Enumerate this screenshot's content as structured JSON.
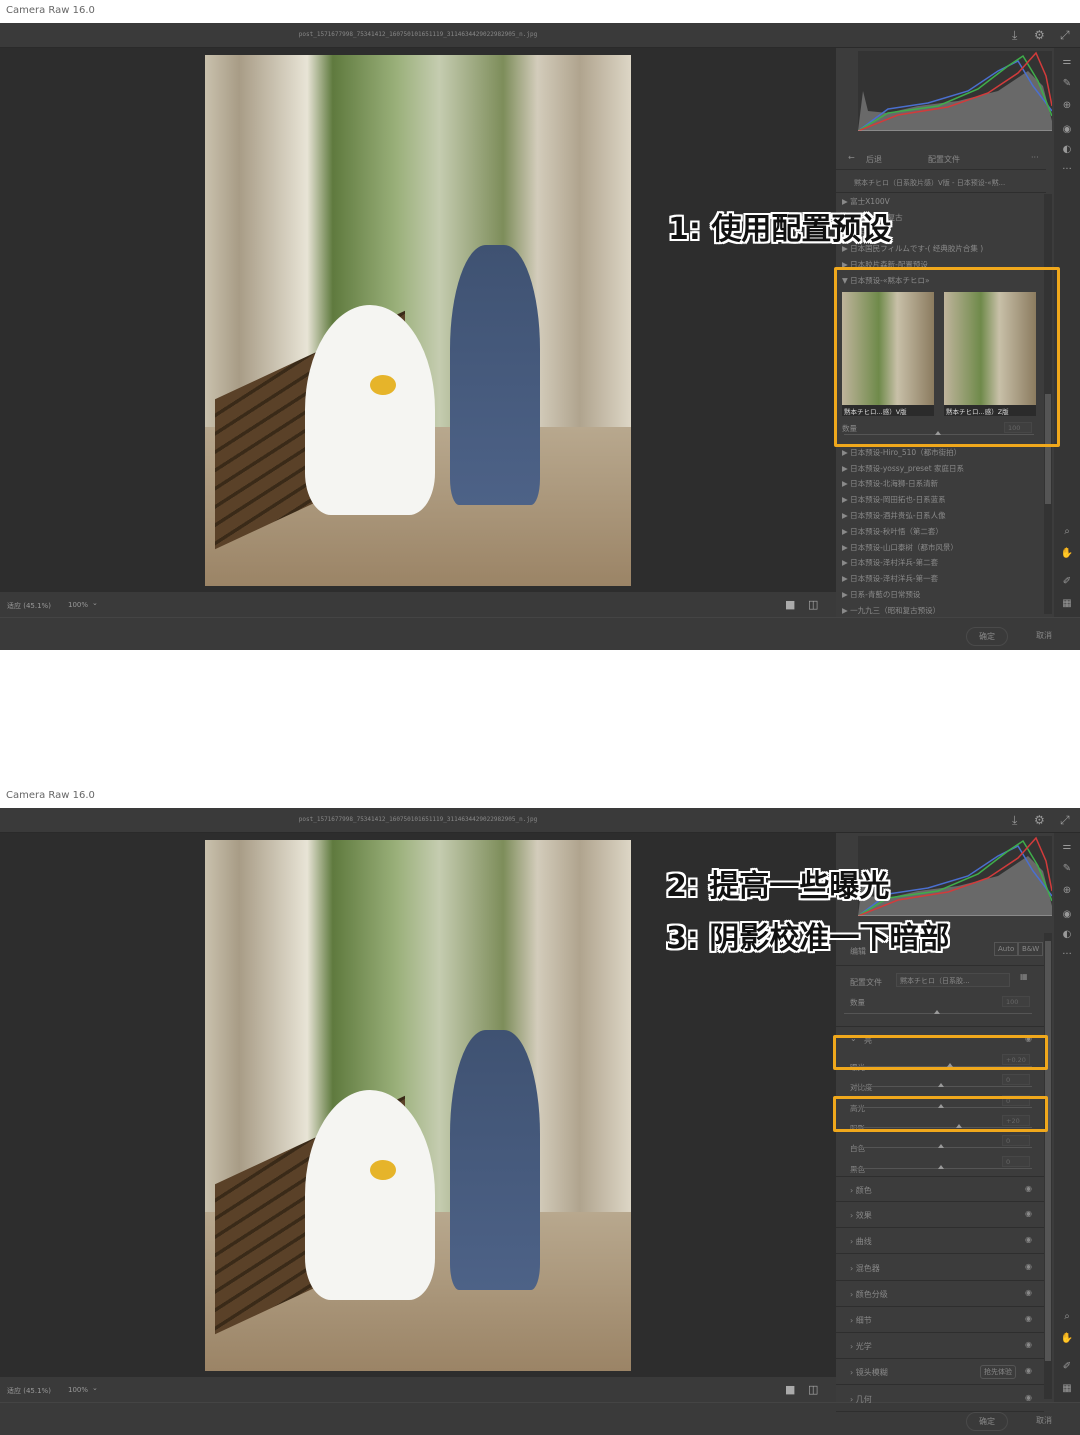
{
  "app_title": "Camera Raw 16.0",
  "filename": "post_1571677998_75341412_160750101651119_3114634429022982905_n.jpg",
  "icons": {
    "save": "download-icon",
    "settings": "gear-icon",
    "fullscreen": "expand-icon",
    "zoom": "magnifier-icon",
    "hand": "hand-icon",
    "eyedropper": "eyedropper-icon",
    "grid": "grid-icon",
    "eye": "eye-icon"
  },
  "status": {
    "fit": "适应 (45.1%)",
    "zoom100": "100%"
  },
  "footer": {
    "ok": "确定",
    "cancel": "取消"
  },
  "accent": "#f0a81c",
  "top": {
    "annotation": "1: 使用配置预设",
    "header": {
      "back": "后退",
      "title": "配置文件",
      "more": "···"
    },
    "profile_title": "黙本チヒロ（日系胶片感）V版 - 日本预设-«黙...",
    "items_before": [
      "富士X100V",
      "日系胶片和复古",
      "复古",
      "日本国民フィルムです-( 经典胶片合集 )",
      "日本胶片森新-配置预设"
    ],
    "group_label": "日本预设-«黙本チヒロ»",
    "thumbs": [
      "黙本チヒロ...感）V版",
      "黙本チヒロ...感）Z版"
    ],
    "amount_label": "数量",
    "amount_value": "100",
    "items_after": [
      "日本预设-Hiro_510（都市街拍）",
      "日本预设-yossy_preset 家庭日系",
      "日本预设-北海狮-日系清新",
      "日本预设-岡田拓也-日系蓝系",
      "日本预设-酒井贵弘-日系人像",
      "日本预设-秋叶悟（第二套）",
      "日本预设-山口泰树（都市风景）",
      "日本预设-泽村洋兵-第二套",
      "日本预设-泽村洋兵-第一套",
      "日系-青藍の日常预设",
      "一九九三（昭和复古预设）"
    ]
  },
  "bottom": {
    "annotations": [
      "2: 提高一些曝光",
      "3: 阴影校准一下暗部"
    ],
    "edit_label": "编辑",
    "auto": "Auto",
    "bw": "B&W",
    "profile_label": "配置文件",
    "profile_value": "黙本チヒロ（日系胶...",
    "amount_label": "数量",
    "amount_value": "100",
    "light_label": "亮",
    "sliders": [
      {
        "label": "曝光",
        "value": "+0.20",
        "pos": 0.55
      },
      {
        "label": "对比度",
        "value": "0",
        "pos": 0.5
      },
      {
        "label": "高光",
        "value": "0",
        "pos": 0.5
      },
      {
        "label": "阴影",
        "value": "+20",
        "pos": 0.6
      },
      {
        "label": "白色",
        "value": "0",
        "pos": 0.5
      },
      {
        "label": "黑色",
        "value": "0",
        "pos": 0.5
      }
    ],
    "sections": [
      "颜色",
      "效果",
      "曲线",
      "混色器",
      "颜色分级",
      "细节",
      "光学",
      "镜头模糊",
      "几何"
    ],
    "lens_blur_badge": "抢先体验"
  }
}
